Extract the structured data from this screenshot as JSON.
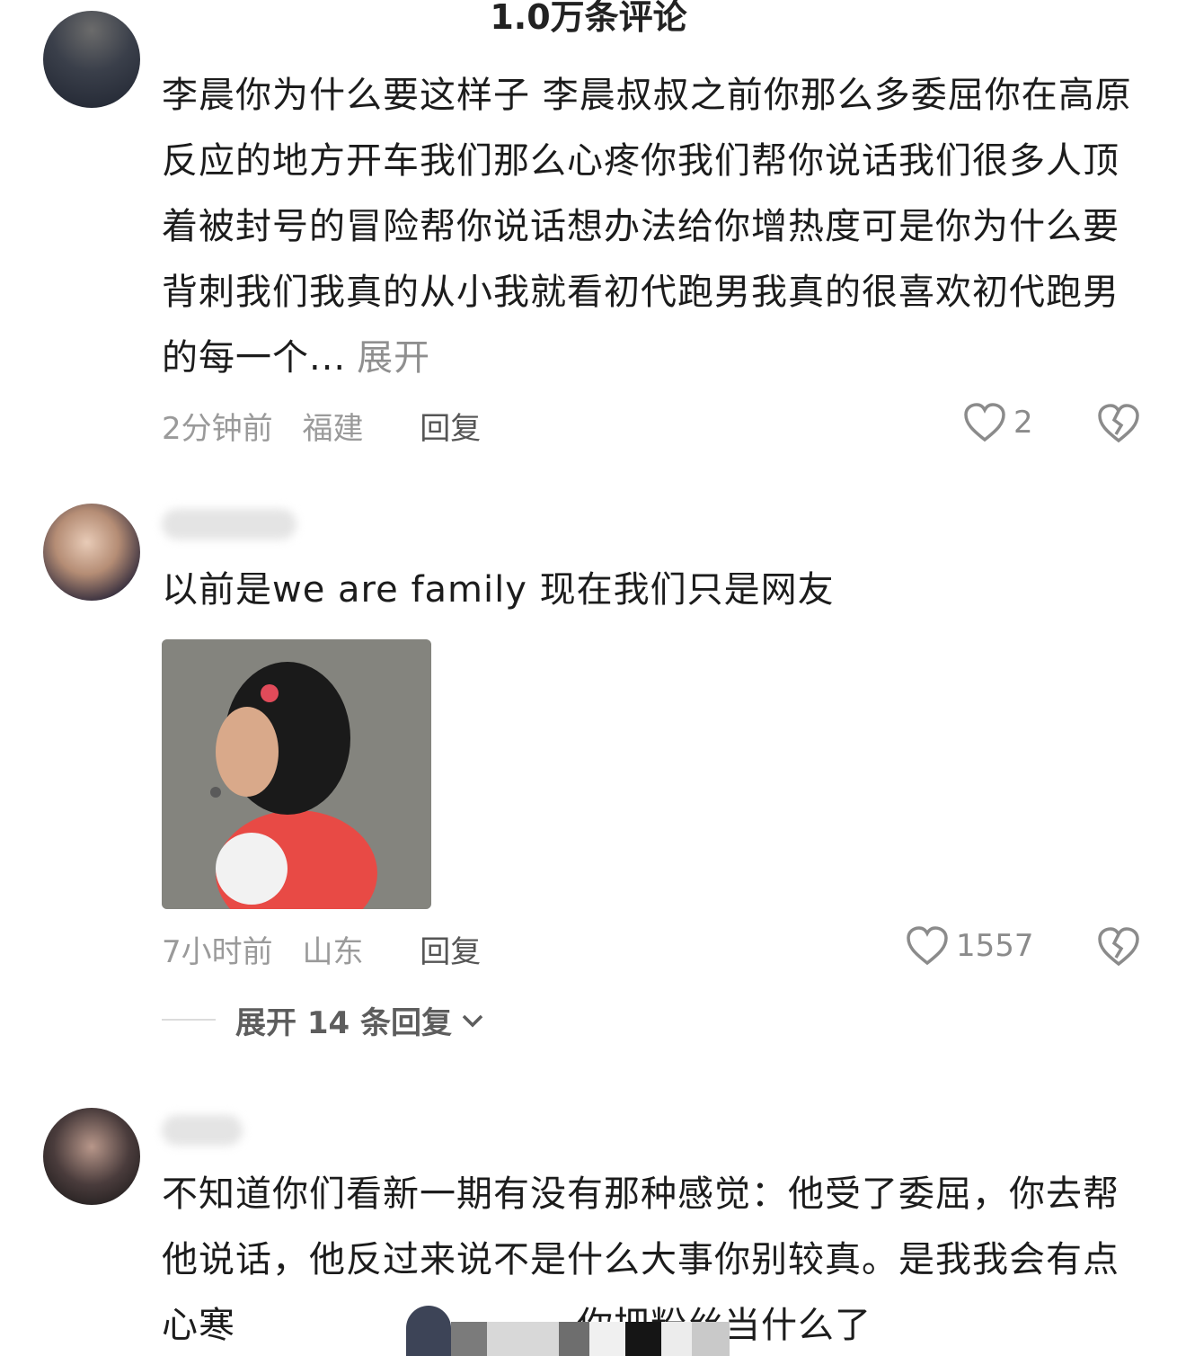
{
  "header": {
    "title": "1.0万条评论"
  },
  "comments": [
    {
      "text": "李晨你为什么要这样子 李晨叔叔之前你那么多委屈你在高原反应的地方开车我们那么心疼你我们帮你说话我们很多人顶着被封号的冒险帮你说话想办法给你增热度可是你为什么要背刺我们我真的从小我就看初代跑男我真的很喜欢初代跑男的每一个...",
      "more": "展开",
      "time": "2分钟前",
      "location": "福建",
      "reply": "回复",
      "likes": "2"
    },
    {
      "text": "以前是we are family 现在我们只是网友",
      "time": "7小时前",
      "location": "山东",
      "reply": "回复",
      "likes": "1557",
      "expand_replies": "展开 14 条回复"
    },
    {
      "text": "不知道你们看新一期有没有那种感觉：他受了委屈，你去帮他说话，他反过来说不是什么大事你别较真。是我我会有点心寒",
      "text_tail": "你把粉丝当什么了"
    }
  ],
  "icons": {
    "like": "heart-outline-icon",
    "dislike": "broken-heart-icon",
    "expand": "chevron-down-icon"
  },
  "colors": {
    "meta": "#9a9a9a",
    "text": "#1c1c1c",
    "background": "#ffffff"
  }
}
